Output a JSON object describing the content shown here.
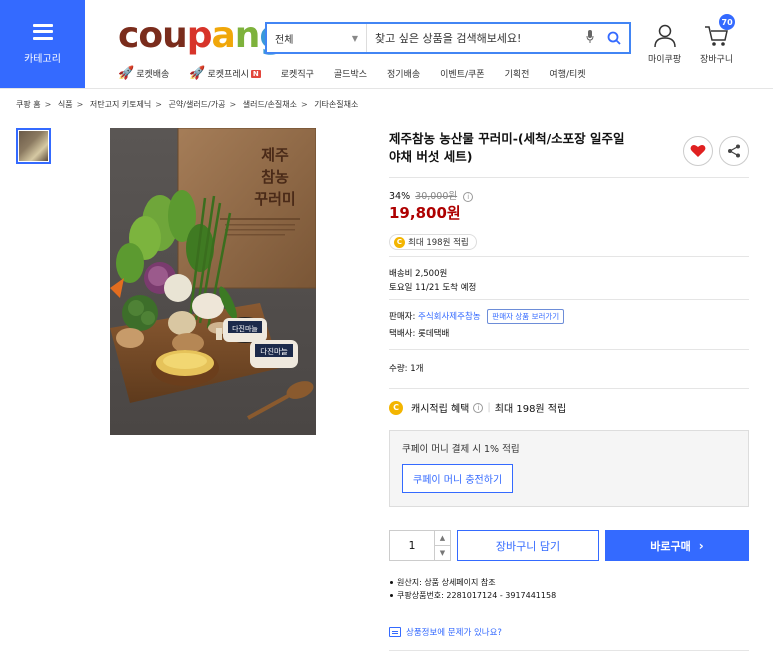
{
  "header": {
    "category_label": "카테고리",
    "logo": [
      "cou",
      "p",
      "a",
      "n",
      "g"
    ],
    "search": {
      "category": "전체",
      "placeholder": "찾고 싶은 상품을 검색해보세요!"
    },
    "my_coupang": "마이쿠팡",
    "cart": "장바구니",
    "cart_count": "70",
    "nav": [
      {
        "label": "로켓배송",
        "icon": "rocket-icon"
      },
      {
        "label": "로켓프레시",
        "icon": "rocket-fresh-icon",
        "badge": "N"
      },
      {
        "label": "로켓직구"
      },
      {
        "label": "골드박스"
      },
      {
        "label": "정기배송"
      },
      {
        "label": "이벤트/쿠폰"
      },
      {
        "label": "기획전"
      },
      {
        "label": "여행/티켓"
      }
    ]
  },
  "breadcrumb": [
    "쿠팡 홈",
    "식품",
    "저탄고지 키토제닉",
    "곤약/샐러드/가공",
    "샐러드/손질채소",
    "기타손질채소"
  ],
  "product": {
    "title": "제주참농 농산물 꾸러미-(세척/소포장 일주일 야채 버섯 세트)",
    "image_text": {
      "box_title_1": "제주",
      "box_title_2": "참농",
      "box_title_3": "꾸러미",
      "container_1": "다진마늘",
      "container_2": "다진마늘"
    },
    "discount_rate": "34%",
    "original_price": "30,000원",
    "price": "19,800원",
    "reward": "최대 198원 적립",
    "shipping_fee": "배송비 2,500원",
    "arrival": "토요일 11/21 도착 예정",
    "seller_label": "판매자:",
    "seller_name": "주식회사제주참농",
    "seller_tip": "판매자 상품 보러가기",
    "courier": "택배사: 롯데택배",
    "quantity_label": "수량: 1개",
    "cash_reward_label": "캐시적립 혜택",
    "cash_reward_value": "최대 198원 적립",
    "coupay_text": "쿠페이 머니 결제 시 1% 적립",
    "coupay_button": "쿠페이 머니 충전하기",
    "qty_value": "1",
    "cart_button": "장바구니 담기",
    "buy_button": "바로구매",
    "details": [
      "원산지: 상품 상세페이지 참조",
      "쿠팡상품번호: 2281017124 - 3917441158"
    ],
    "report_link": "상품정보에 문제가 있나요?"
  },
  "colors": {
    "accent": "#346aff",
    "price": "#ae0000",
    "coin": "#f3b500",
    "heart": "#e02020"
  }
}
